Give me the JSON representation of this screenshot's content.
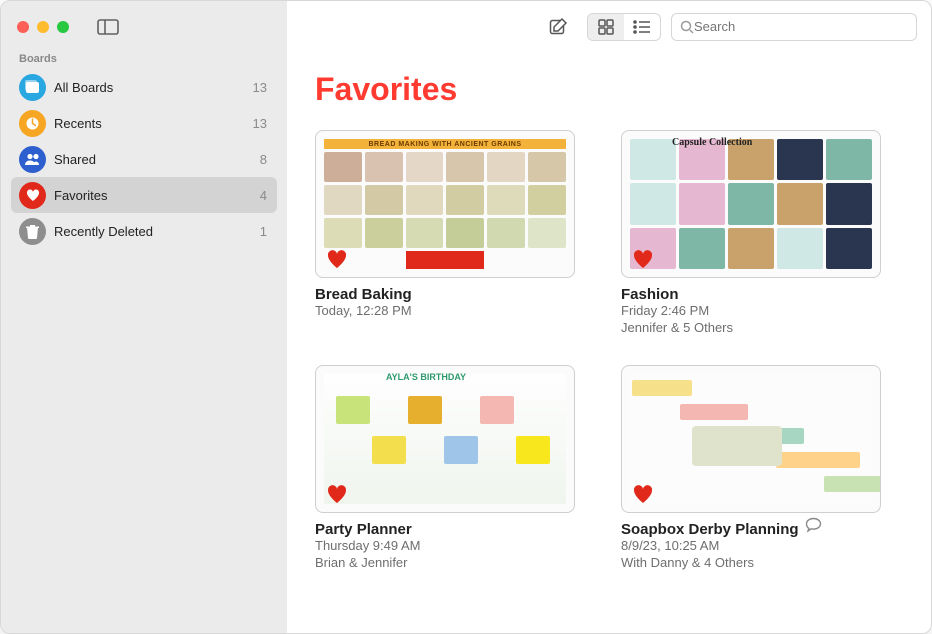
{
  "sidebar": {
    "section_label": "Boards",
    "items": [
      {
        "icon": "board-icon",
        "color": "#29a7e0",
        "label": "All Boards",
        "count": "13"
      },
      {
        "icon": "clock-icon",
        "color": "#f6a623",
        "label": "Recents",
        "count": "13"
      },
      {
        "icon": "people-icon",
        "color": "#2d5fcf",
        "label": "Shared",
        "count": "8"
      },
      {
        "icon": "heart-icon",
        "color": "#e1291b",
        "label": "Favorites",
        "count": "4"
      },
      {
        "icon": "trash-icon",
        "color": "#8e8e8e",
        "label": "Recently Deleted",
        "count": "1"
      }
    ],
    "selected_index": 3
  },
  "topbar": {
    "search_placeholder": "Search"
  },
  "page": {
    "title": "Favorites"
  },
  "boards": [
    {
      "title": "Bread Baking",
      "subtitle": "Today, 12:28 PM",
      "shared": "",
      "has_chat": false,
      "thumb_hint": "BREAD MAKING WITH ANCIENT GRAINS"
    },
    {
      "title": "Fashion",
      "subtitle": "Friday 2:46 PM",
      "shared": "Jennifer & 5 Others",
      "has_chat": false,
      "thumb_hint": "Capsule Collection"
    },
    {
      "title": "Party Planner",
      "subtitle": "Thursday 9:49 AM",
      "shared": "Brian & Jennifer",
      "has_chat": false,
      "thumb_hint": "AYLA'S BIRTHDAY"
    },
    {
      "title": "Soapbox Derby Planning",
      "subtitle": "8/9/23, 10:25 AM",
      "shared": "With Danny & 4 Others",
      "has_chat": true,
      "thumb_hint": ""
    }
  ]
}
